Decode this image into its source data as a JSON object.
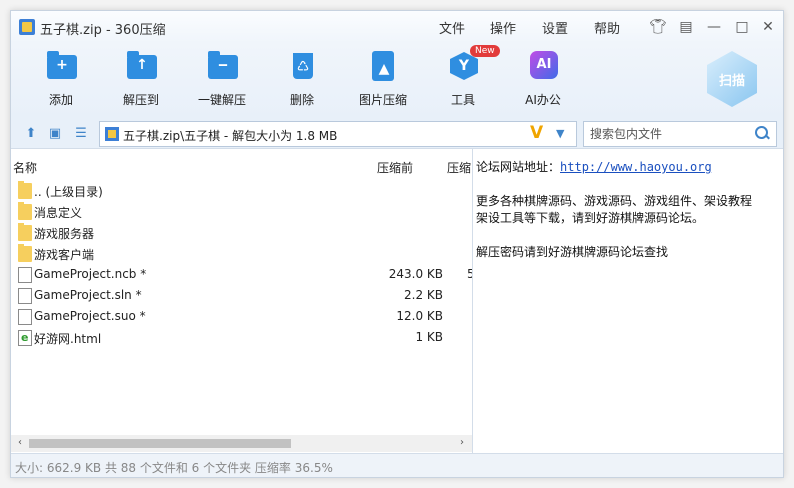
{
  "window": {
    "title": "五子棋.zip - 360压缩"
  },
  "menu": [
    "文件",
    "操作",
    "设置",
    "帮助"
  ],
  "toolbar": {
    "items": [
      {
        "label": "添加",
        "icon": "add-icon"
      },
      {
        "label": "解压到",
        "icon": "extract-to-icon"
      },
      {
        "label": "一键解压",
        "icon": "one-click-extract-icon"
      },
      {
        "label": "删除",
        "icon": "delete-icon"
      },
      {
        "label": "图片压缩",
        "icon": "image-compress-icon"
      },
      {
        "label": "工具",
        "icon": "tools-icon",
        "badge": "New"
      },
      {
        "label": "AI办公",
        "icon": "ai-office-icon",
        "glyph": "AI"
      }
    ],
    "scan_label": "扫描"
  },
  "address": {
    "path": "五子棋.zip\\五子棋 - 解包大小为 1.8 MB",
    "search_placeholder": "搜索包内文件"
  },
  "columns": {
    "name": "名称",
    "size": "压缩前",
    "packed": "压缩"
  },
  "files": [
    {
      "name": ".. (上级目录)",
      "type": "folder",
      "size": "",
      "packed": ""
    },
    {
      "name": "消息定义",
      "type": "folder",
      "size": "",
      "packed": ""
    },
    {
      "name": "游戏服务器",
      "type": "folder",
      "size": "",
      "packed": ""
    },
    {
      "name": "游戏客户端",
      "type": "folder",
      "size": "",
      "packed": ""
    },
    {
      "name": "GameProject.ncb *",
      "type": "file",
      "size": "243.0 KB",
      "packed": "5"
    },
    {
      "name": "GameProject.sln *",
      "type": "file",
      "size": "2.2 KB",
      "packed": ""
    },
    {
      "name": "GameProject.suo *",
      "type": "file",
      "size": "12.0 KB",
      "packed": ""
    },
    {
      "name": "好游网.html",
      "type": "html",
      "size": "1 KB",
      "packed": ""
    }
  ],
  "notes": {
    "line1_prefix": "论坛网站地址：",
    "line1_link": "http://www.haoyou.org",
    "line2": "更多各种棋牌源码、游戏源码、游戏组件、架设教程",
    "line3": "架设工具等下载，请到好游棋牌源码论坛。",
    "line4": "解压密码请到好游棋牌源码论坛查找"
  },
  "status": "大小: 662.9 KB 共 88 个文件和 6 个文件夹 压缩率 36.5%"
}
